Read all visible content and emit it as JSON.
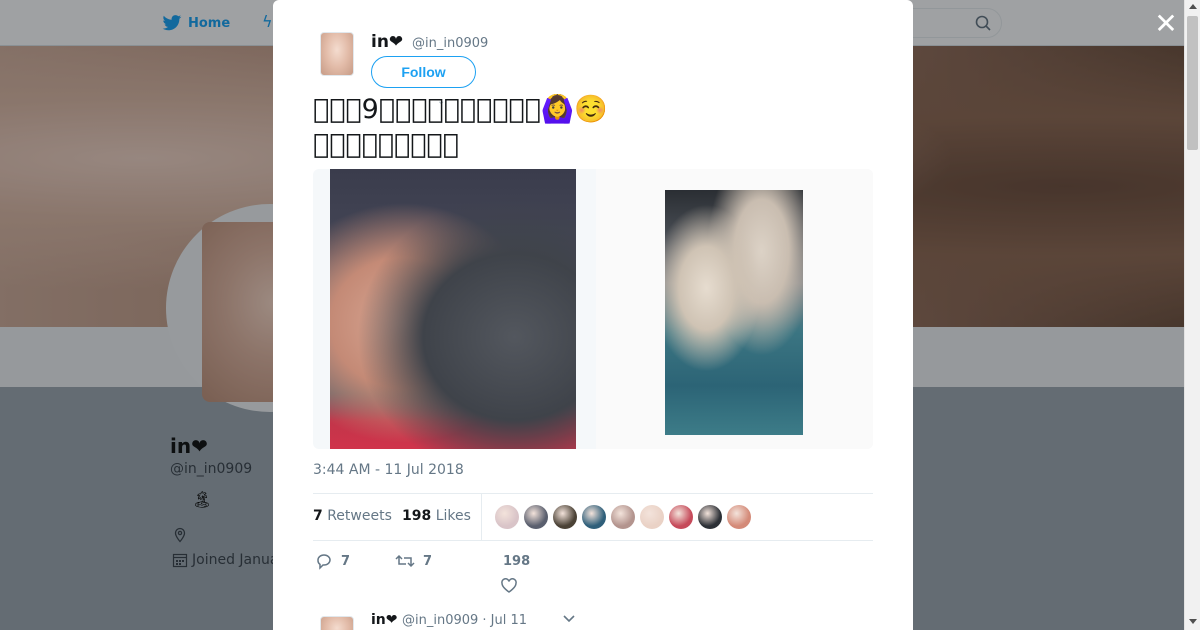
{
  "topnav": {
    "home_label": "Home"
  },
  "background_profile": {
    "name": "in❤",
    "handle": "@in_in0909",
    "bio_emoji": "🏝",
    "joined_text": "Joined Janua"
  },
  "modal": {
    "close_glyph": "✕",
    "author": {
      "name": "in❤",
      "handle": "@in_in0909",
      "follow_label": "Follow"
    },
    "tweet_text": "\u0000\u0000\u00009\u0000\u0000\u0000\u0000\u0000\u0000\u0000\u0000\u0000\u0000🙆‍♀️☺️\n\u0000\u0000\u0000\u0000\u0000\u0000\u0000\u0000\u0000",
    "timestamp": "3:44 AM - 11 Jul 2018",
    "stats": {
      "retweets_count": "7",
      "retweets_label": "Retweets",
      "likes_count": "198",
      "likes_label": "Likes"
    },
    "liker_colors": [
      "#d9c4c8",
      "#5a5f6e",
      "#4b4236",
      "#2f5f7a",
      "#b3948e",
      "#ead2c6",
      "#c64a5a",
      "#2c3036",
      "#d48a78"
    ],
    "actions": {
      "reply_count": "7",
      "retweet_count": "7",
      "like_count": "198"
    },
    "reply_preview": {
      "name": "in❤",
      "handle": "@in_in0909 · Jul 11"
    }
  }
}
